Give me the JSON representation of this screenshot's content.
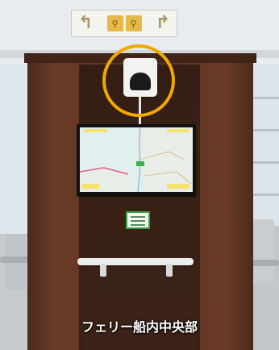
{
  "caption": "フェリー船内中央部",
  "sign": {
    "left_icon": "arrow-up-left-icon",
    "right_icon": "arrow-up-right-icon",
    "center_icons": [
      "restroom-icon",
      "restroom-icon"
    ]
  },
  "device": {
    "icon": "wifi-router-icon"
  },
  "highlight": {
    "color": "#f0a800"
  },
  "tv": {
    "content": "navigation-map"
  },
  "notice": {
    "border_color": "#35a44a"
  }
}
